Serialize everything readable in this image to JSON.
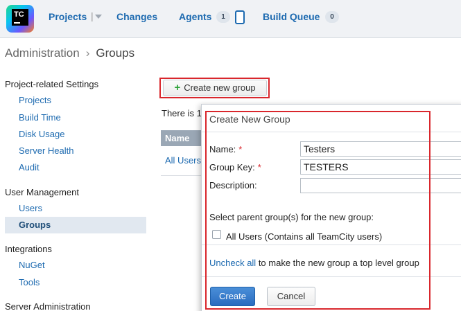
{
  "logo": {
    "text": "TC"
  },
  "topnav": {
    "projects_label": "Projects",
    "changes_label": "Changes",
    "agents_label": "Agents",
    "agents_count": "1",
    "build_queue_label": "Build Queue",
    "build_queue_count": "0"
  },
  "breadcrumb": {
    "root": "Administration",
    "current": "Groups"
  },
  "sidebar": {
    "sections": [
      {
        "heading": "Project-related Settings",
        "items": [
          "Projects",
          "Build Time",
          "Disk Usage",
          "Server Health",
          "Audit"
        ]
      },
      {
        "heading": "User Management",
        "items": [
          "Users",
          "Groups"
        ]
      },
      {
        "heading": "Integrations",
        "items": [
          "NuGet",
          "Tools"
        ]
      },
      {
        "heading": "Server Administration",
        "items": []
      }
    ],
    "active_item": "Groups"
  },
  "main": {
    "create_button_label": "Create new group",
    "there_is_text": "There is 1",
    "table_header_name": "Name",
    "table_row_name": "All Users"
  },
  "dialog": {
    "title": "Create New Group",
    "name_label": "Name:",
    "name_value": "Testers",
    "group_key_label": "Group Key:",
    "group_key_value": "TESTERS",
    "description_label": "Description:",
    "description_value": "",
    "required_marker": "*",
    "parent_groups_text": "Select parent group(s) for the new group:",
    "all_users_checkbox_label": "All Users (Contains all TeamCity users)",
    "all_users_checked": false,
    "uncheck_all_link": "Uncheck all",
    "uncheck_all_suffix": " to make the new group a top level group",
    "create_button": "Create",
    "cancel_button": "Cancel"
  },
  "colors": {
    "link": "#1d6ab0",
    "highlight_outline": "#d9262c",
    "primary_button": "#2a6bbf",
    "plus_icon": "#2aa236"
  }
}
